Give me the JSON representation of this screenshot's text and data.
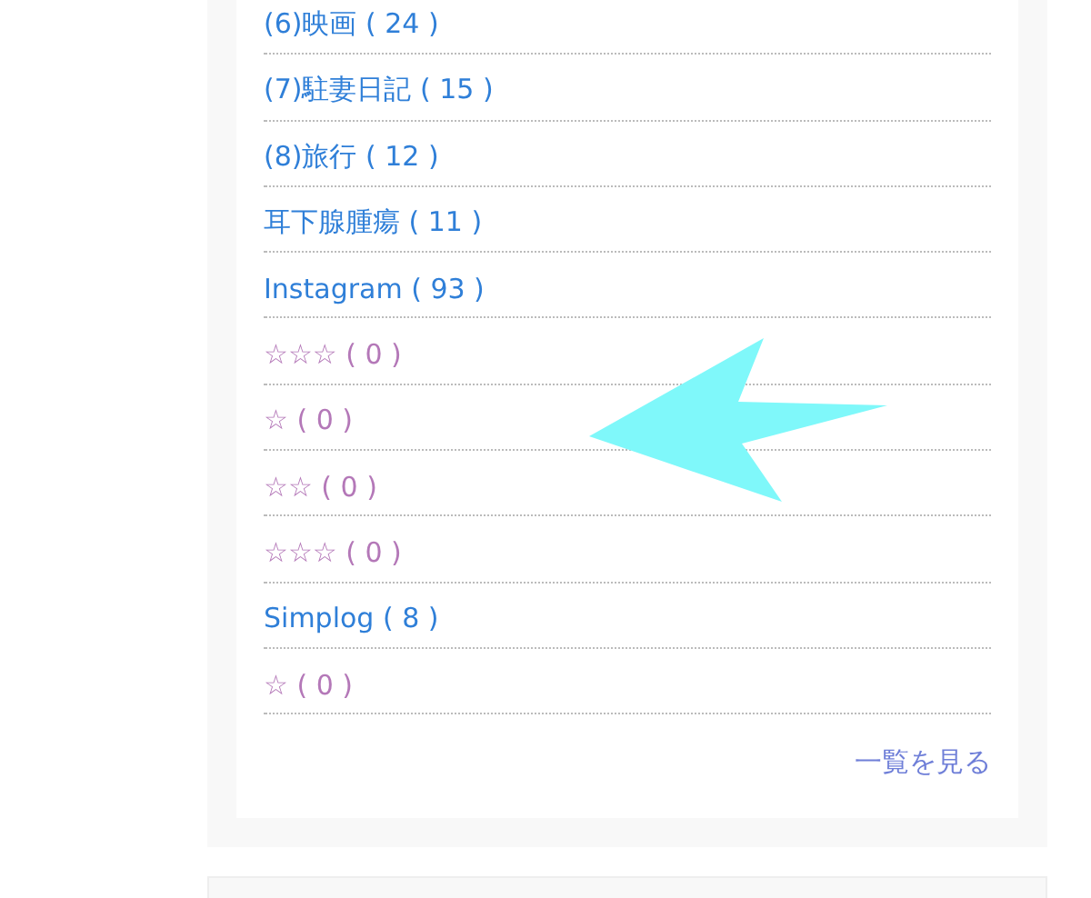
{
  "categories": [
    {
      "label": "(6)映画 ( 24 )",
      "visited": false
    },
    {
      "label": "(7)駐妻日記 ( 15 )",
      "visited": false
    },
    {
      "label": "(8)旅行 ( 12 )",
      "visited": false
    },
    {
      "label": "耳下腺腫瘍 ( 11 )",
      "visited": false
    },
    {
      "label": "Instagram ( 93 )",
      "visited": false
    },
    {
      "label": "☆☆☆ ( 0 )",
      "visited": true
    },
    {
      "label": "☆ ( 0 )",
      "visited": true
    },
    {
      "label": "☆☆ ( 0 )",
      "visited": true
    },
    {
      "label": "☆☆☆ ( 0 )",
      "visited": true
    },
    {
      "label": "Simplog ( 8 )",
      "visited": false
    },
    {
      "label": "☆ ( 0 )",
      "visited": true
    }
  ],
  "more_link": "一覧を見る"
}
